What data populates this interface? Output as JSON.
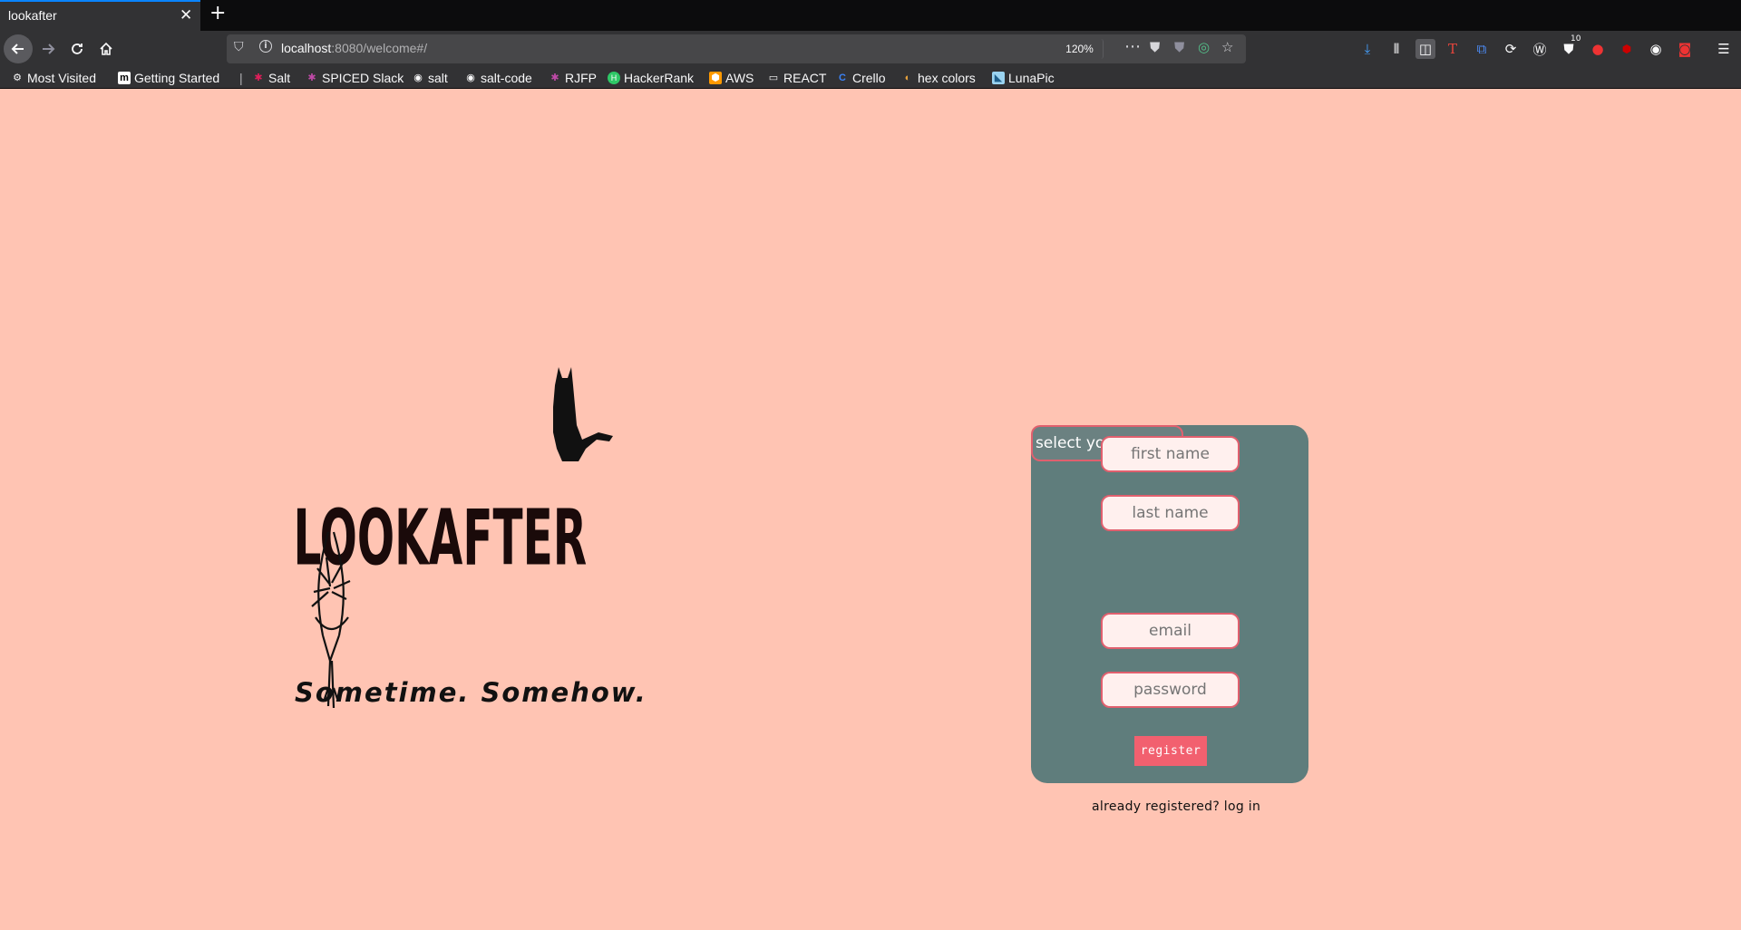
{
  "browser": {
    "tab_title": "lookafter",
    "tab_close": "✕",
    "new_tab": "+",
    "url_host": "localhost",
    "url_path": ":8080/welcome#/",
    "zoom": "120%",
    "downloads_badge": "10"
  },
  "bookmarks": [
    {
      "label": "Most Visited",
      "icon": "gear-icon"
    },
    {
      "label": "Getting Started",
      "icon": "medium-icon"
    },
    {
      "label": "Salt",
      "icon": "slack-icon"
    },
    {
      "label": "SPICED Slack",
      "icon": "slack-icon"
    },
    {
      "label": "salt",
      "icon": "github-icon"
    },
    {
      "label": "salt-code",
      "icon": "github-icon"
    },
    {
      "label": "RJFP",
      "icon": "slack-icon"
    },
    {
      "label": "HackerRank",
      "icon": "hackerrank-icon"
    },
    {
      "label": "AWS",
      "icon": "aws-icon"
    },
    {
      "label": "REACT",
      "icon": "folder-icon"
    },
    {
      "label": "Crello",
      "icon": "crello-icon"
    },
    {
      "label": "hex colors",
      "icon": "hex-icon"
    },
    {
      "label": "LunaPic",
      "icon": "lunapic-icon"
    }
  ],
  "logo": {
    "wordmark": "LOOKAFTER"
  },
  "tagline": "Sometime. Somehow.",
  "form": {
    "first_name_placeholder": "first name",
    "last_name_placeholder": "last name",
    "hood_select": "select your hood...",
    "email_placeholder": "email",
    "password_placeholder": "password",
    "register_label": "register"
  },
  "login_link": "already registered? log in",
  "colors": {
    "page_bg": "#ffc4b3",
    "card_bg": "#5f7d7c",
    "accent": "#f2606f"
  }
}
